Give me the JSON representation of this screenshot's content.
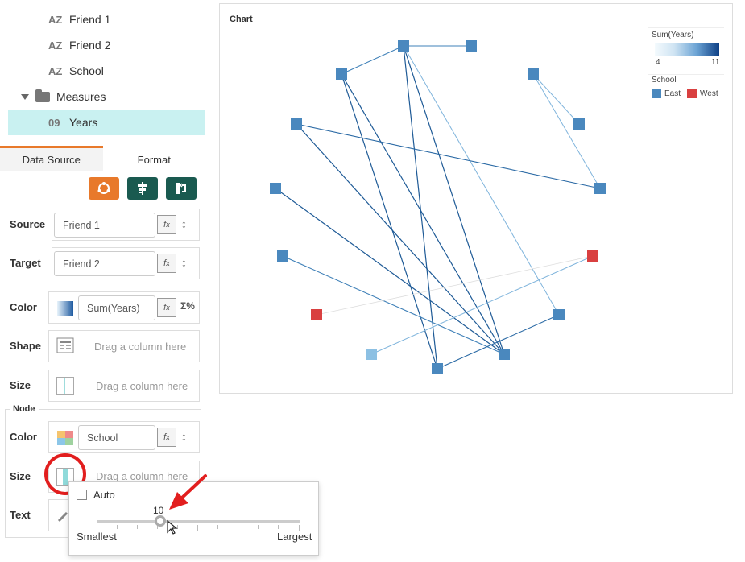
{
  "tree": {
    "items": [
      {
        "icon": "AZ",
        "label": "Friend 1"
      },
      {
        "icon": "AZ",
        "label": "Friend 2"
      },
      {
        "icon": "AZ",
        "label": "School"
      }
    ],
    "folder_label": "Measures",
    "measure": {
      "icon": "09",
      "label": "Years"
    }
  },
  "tabs": {
    "data_source": "Data Source",
    "format": "Format"
  },
  "toolbar": {
    "colors": {
      "orange": "#e8792b",
      "teal": "#1a5a50"
    },
    "icons": [
      "network-chart-icon",
      "align-icon",
      "swap-icon"
    ]
  },
  "fields": {
    "source": {
      "label": "Source",
      "value": "Friend 1"
    },
    "target": {
      "label": "Target",
      "value": "Friend 2"
    },
    "color": {
      "label": "Color",
      "value": "Sum(Years)"
    },
    "shape": {
      "label": "Shape",
      "placeholder": "Drag a column here"
    },
    "size": {
      "label": "Size",
      "placeholder": "Drag a column here"
    }
  },
  "node": {
    "title": "Node",
    "color": {
      "label": "Color",
      "value": "School"
    },
    "size": {
      "label": "Size",
      "placeholder": "Drag a column here"
    },
    "text": {
      "label": "Text"
    }
  },
  "popup": {
    "auto_label": "Auto",
    "value": "10",
    "min_label": "Smallest",
    "max_label": "Largest",
    "slider_fraction": 0.26
  },
  "chart": {
    "title": "Chart",
    "legend": {
      "sum_title": "Sum(Years)",
      "min": "4",
      "max": "11",
      "school_title": "School",
      "east": "East",
      "west": "West",
      "east_color": "#4a88be",
      "west_color": "#d94040"
    }
  },
  "chart_data": {
    "type": "network",
    "title": "Chart",
    "color_by": "Sum(Years)",
    "color_range": [
      4,
      11
    ],
    "node_color_by": "School",
    "categories": [
      "East",
      "West"
    ],
    "node_count": 16,
    "west_node_count": 2
  }
}
